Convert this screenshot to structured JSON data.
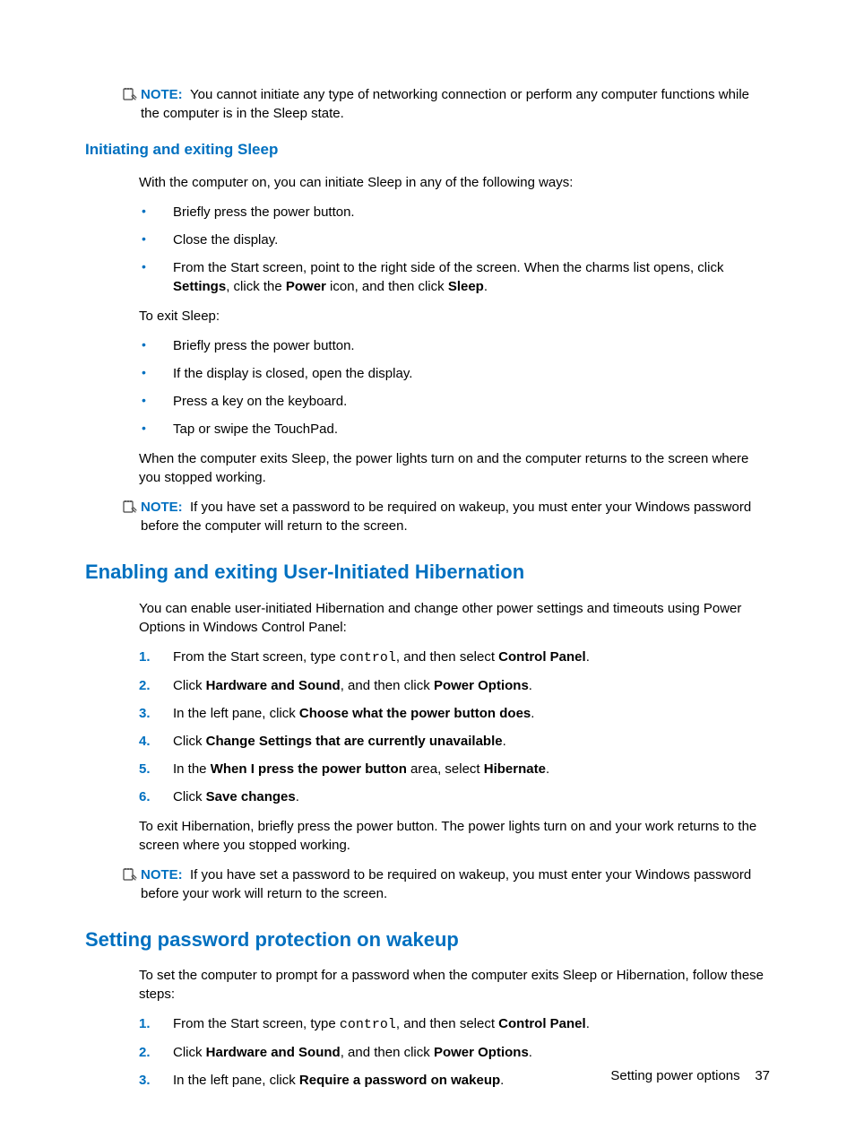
{
  "note_label": "NOTE:",
  "note1": {
    "text": "You cannot initiate any type of networking connection or perform any computer functions while the computer is in the Sleep state."
  },
  "h3_1": "Initiating and exiting Sleep",
  "sleep_intro": "With the computer on, you can initiate Sleep in any of the following ways:",
  "sleep_in": {
    "b1": "Briefly press the power button.",
    "b2": "Close the display.",
    "b3_a": "From the Start screen, point to the right side of the screen. When the charms list opens, click ",
    "b3_b1": "Settings",
    "b3_c": ", click the ",
    "b3_b2": "Power",
    "b3_d": " icon, and then click ",
    "b3_b3": "Sleep",
    "b3_e": "."
  },
  "exit_label": "To exit Sleep:",
  "sleep_out": {
    "b1": "Briefly press the power button.",
    "b2": "If the display is closed, open the display.",
    "b3": "Press a key on the keyboard.",
    "b4": "Tap or swipe the TouchPad."
  },
  "sleep_after": "When the computer exits Sleep, the power lights turn on and the computer returns to the screen where you stopped working.",
  "note2": {
    "text": "If you have set a password to be required on wakeup, you must enter your Windows password before the computer will return to the screen."
  },
  "h2_1": "Enabling and exiting User-Initiated Hibernation",
  "hib_intro": "You can enable user-initiated Hibernation and change other power settings and timeouts using Power Options in Windows Control Panel:",
  "hib_steps": {
    "s1_a": "From the Start screen, type ",
    "s1_mono": "control",
    "s1_b": ", and then select ",
    "s1_bold": "Control Panel",
    "s1_c": ".",
    "s2_a": "Click ",
    "s2_b1": "Hardware and Sound",
    "s2_b": ", and then click ",
    "s2_b2": "Power Options",
    "s2_c": ".",
    "s3_a": "In the left pane, click ",
    "s3_b1": "Choose what the power button does",
    "s3_c": ".",
    "s4_a": "Click ",
    "s4_b1": "Change Settings that are currently unavailable",
    "s4_c": ".",
    "s5_a": "In the ",
    "s5_b1": "When I press the power button",
    "s5_b": " area, select ",
    "s5_b2": "Hibernate",
    "s5_c": ".",
    "s6_a": "Click ",
    "s6_b1": "Save changes",
    "s6_c": "."
  },
  "hib_after": "To exit Hibernation, briefly press the power button. The power lights turn on and your work returns to the screen where you stopped working.",
  "note3": {
    "text": "If you have set a password to be required on wakeup, you must enter your Windows password before your work will return to the screen."
  },
  "h2_2": "Setting password protection on wakeup",
  "pwd_intro": "To set the computer to prompt for a password when the computer exits Sleep or Hibernation, follow these steps:",
  "pwd_steps": {
    "s1_a": "From the Start screen, type ",
    "s1_mono": "control",
    "s1_b": ", and then select ",
    "s1_bold": "Control Panel",
    "s1_c": ".",
    "s2_a": "Click ",
    "s2_b1": "Hardware and Sound",
    "s2_b": ", and then click ",
    "s2_b2": "Power Options",
    "s2_c": ".",
    "s3_a": "In the left pane, click ",
    "s3_b1": "Require a password on wakeup",
    "s3_c": "."
  },
  "footer": {
    "section": "Setting power options",
    "page": "37"
  }
}
